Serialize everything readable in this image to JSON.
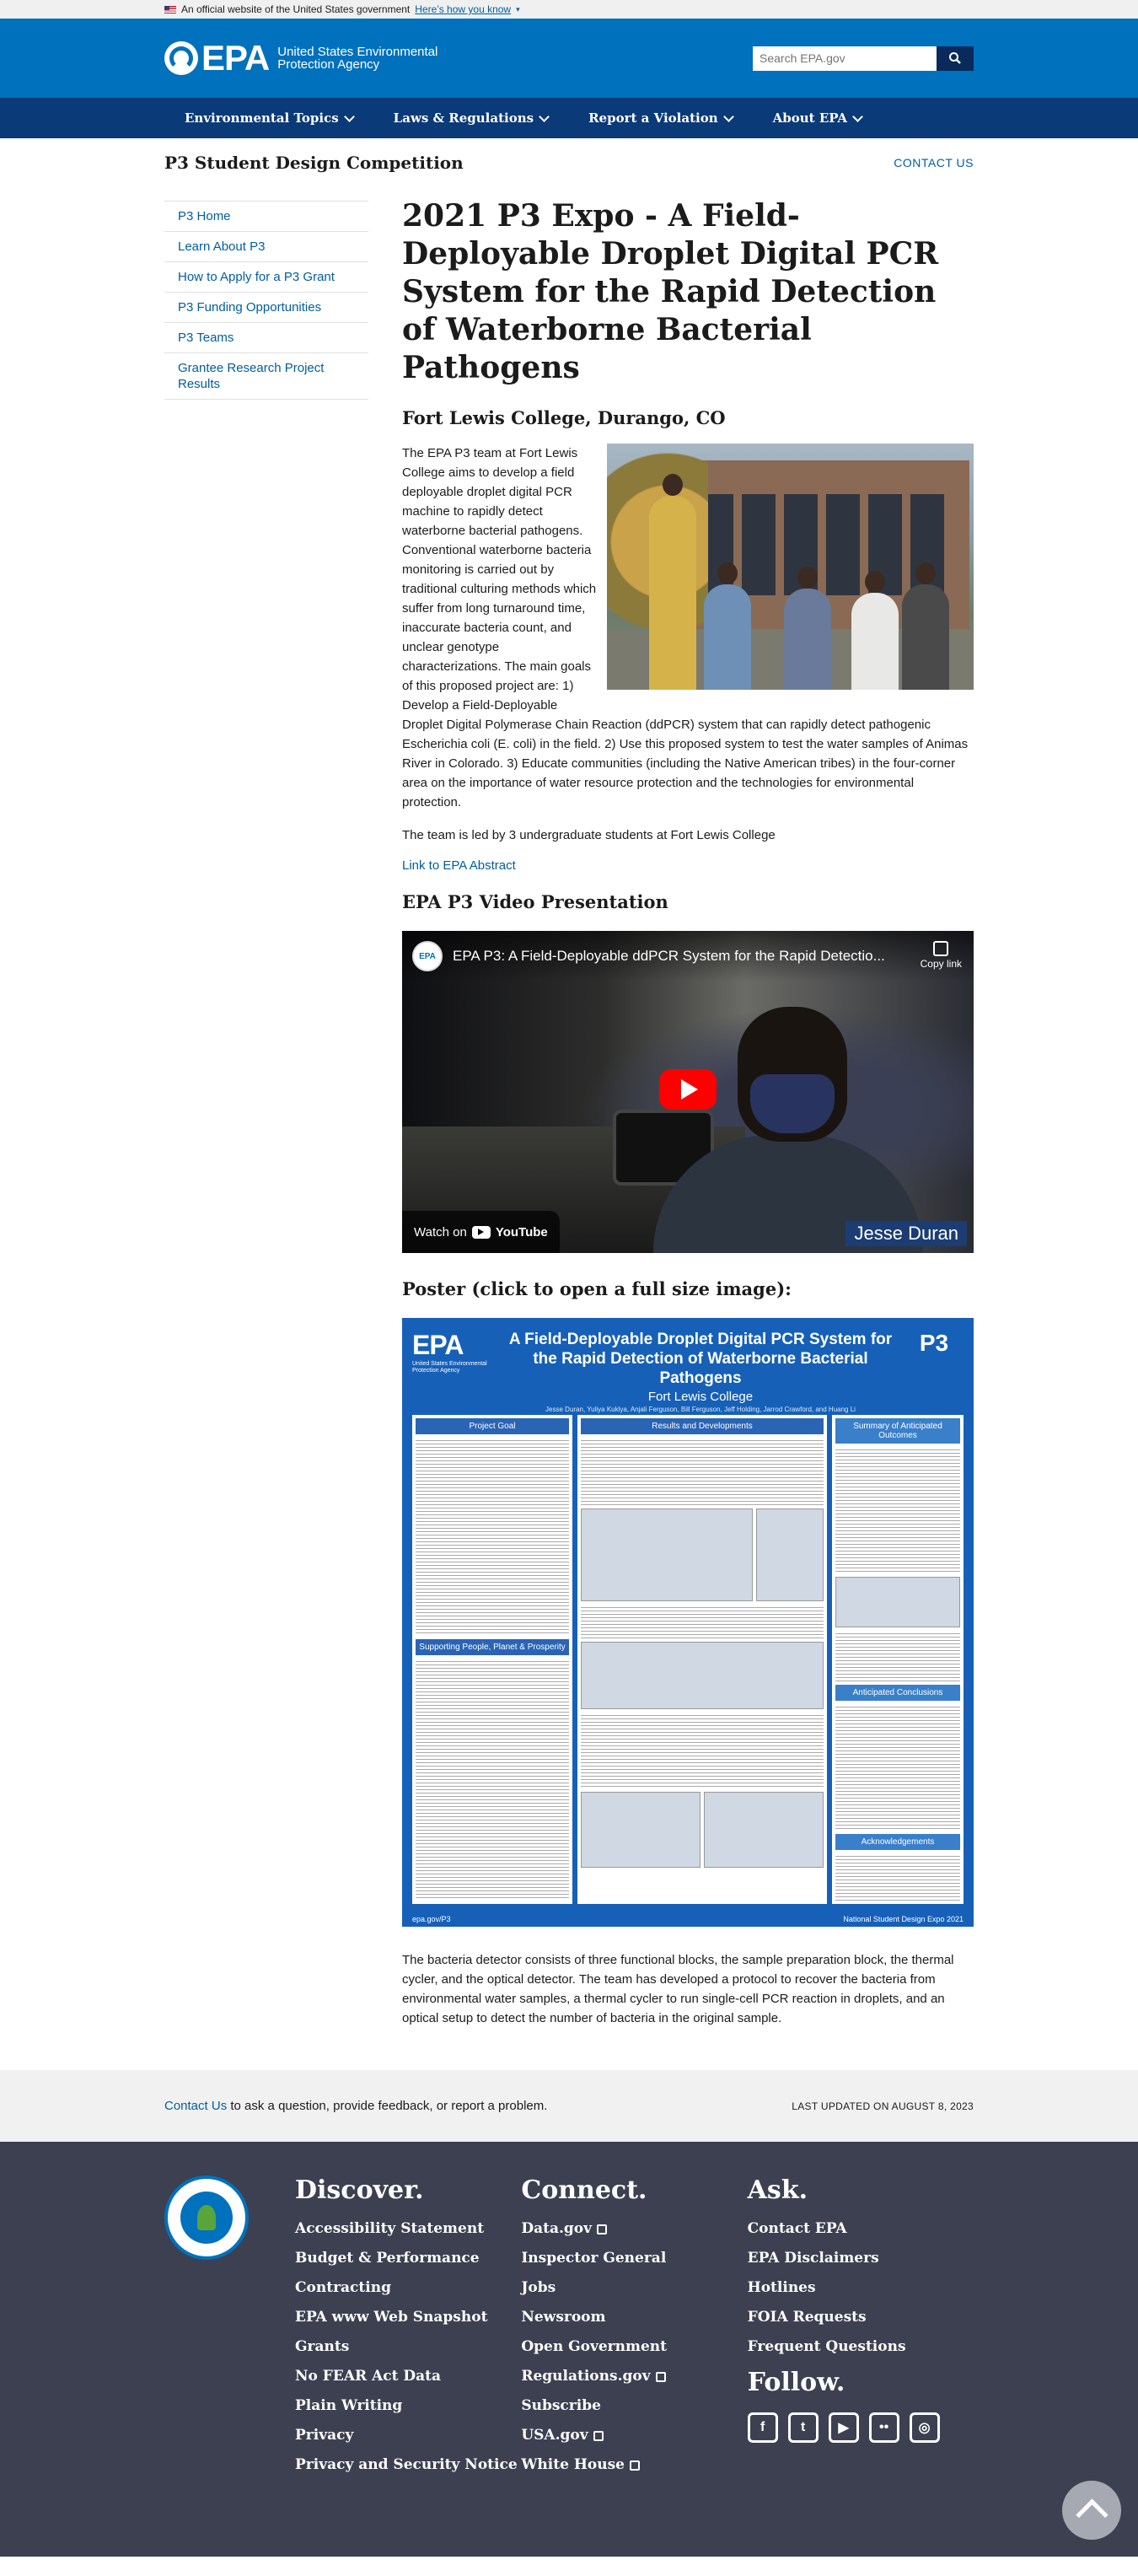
{
  "banner": {
    "text": "An official website of the United States government",
    "link": "Here’s how you know"
  },
  "header": {
    "logo_word": "EPA",
    "agency": "United States Environmental Protection Agency",
    "search_placeholder": "Search EPA.gov"
  },
  "nav": {
    "items": [
      {
        "label": "Environmental Topics"
      },
      {
        "label": "Laws & Regulations"
      },
      {
        "label": "Report a Violation"
      },
      {
        "label": "About EPA"
      }
    ]
  },
  "section": {
    "title": "P3 Student Design Competition",
    "contact": "CONTACT US"
  },
  "sidenav": {
    "items": [
      {
        "label": "P3 Home"
      },
      {
        "label": "Learn About P3"
      },
      {
        "label": "How to Apply for a P3 Grant"
      },
      {
        "label": "P3 Funding Opportunities"
      },
      {
        "label": "P3 Teams"
      },
      {
        "label": "Grantee Research Project Results"
      }
    ]
  },
  "article": {
    "title": "2021 P3 Expo - A Field-Deployable Droplet Digital PCR System for the Rapid Detection of Waterborne Bacterial Pathogens",
    "college": "Fort Lewis College, Durango, CO",
    "intro": "The EPA P3 team at Fort Lewis College aims to develop a field deployable droplet digital PCR machine to rapidly detect waterborne bacterial pathogens. Conventional waterborne bacteria monitoring is carried out by traditional culturing methods which suffer from long turnaround time, inaccurate bacteria count, and unclear genotype characterizations. The main goals of this proposed project are: 1) Develop a Field-Deployable Droplet Digital Polymerase Chain Reaction (ddPCR) system that can rapidly detect pathogenic Escherichia coli (E. coli) in the field. 2) Use this proposed system to test the water samples of Animas River in Colorado. 3) Educate communities (including the Native American tribes) in the four-corner area on the importance of water resource protection and the technologies for environmental protection.",
    "team": "The team is led by 3 undergraduate students at Fort Lewis College",
    "abstract_link": "Link to EPA Abstract",
    "video_heading": "EPA P3 Video Presentation",
    "video_title": "EPA P3: A Field-Deployable ddPCR System for the Rapid Detectio...",
    "copy_link": "Copy link",
    "watch_on": "Watch on",
    "youtube": "YouTube",
    "video_caption": "Jesse Duran",
    "poster_heading": "Poster (click to open a full size image):",
    "detector": "The bacteria detector consists of three functional blocks, the sample preparation block, the thermal cycler, and the optical detector. The team has developed a protocol to recover the bacteria from environmental water samples, a thermal cycler to run single-cell PCR reaction in droplets, and an optical setup to detect the number of bacteria in the original sample."
  },
  "poster": {
    "logo": "EPA",
    "logo_sub": "United States Environmental Protection Agency",
    "title": "A Field-Deployable Droplet Digital PCR System for the Rapid Detection of Waterborne Bacterial Pathogens",
    "college": "Fort Lewis College",
    "authors": "Jesse Duran, Yuliya Kuklya, Anjali Ferguson, Bill Ferguson, Jeff Holding, Jarrod Crawford, and Huang Li",
    "p3": "P3",
    "sections": [
      "Project Goal",
      "Results and Developments",
      "Summary of Anticipated Outcomes",
      "Supporting People, Planet & Prosperity",
      "Anticipated Conclusions",
      "Acknowledgements"
    ],
    "footer_left": "epa.gov/P3",
    "footer_right": "National Student Design Expo 2021"
  },
  "band": {
    "contact_link": "Contact Us",
    "contact_rest": " to ask a question, provide feedback, or report a problem.",
    "updated": "LAST UPDATED ON AUGUST 8, 2023"
  },
  "footer": {
    "discover": {
      "title": "Discover.",
      "items": [
        "Accessibility Statement",
        "Budget & Performance",
        "Contracting",
        "EPA www Web Snapshot",
        "Grants",
        "No FEAR Act Data",
        "Plain Writing",
        "Privacy",
        "Privacy and Security Notice"
      ]
    },
    "connect": {
      "title": "Connect.",
      "items": [
        "Data.gov",
        "Inspector General",
        "Jobs",
        "Newsroom",
        "Open Government",
        "Regulations.gov",
        "Subscribe",
        "USA.gov",
        "White House"
      ]
    },
    "ask": {
      "title": "Ask.",
      "items": [
        "Contact EPA",
        "EPA Disclaimers",
        "Hotlines",
        "FOIA Requests",
        "Frequent Questions"
      ]
    },
    "follow": "Follow."
  }
}
